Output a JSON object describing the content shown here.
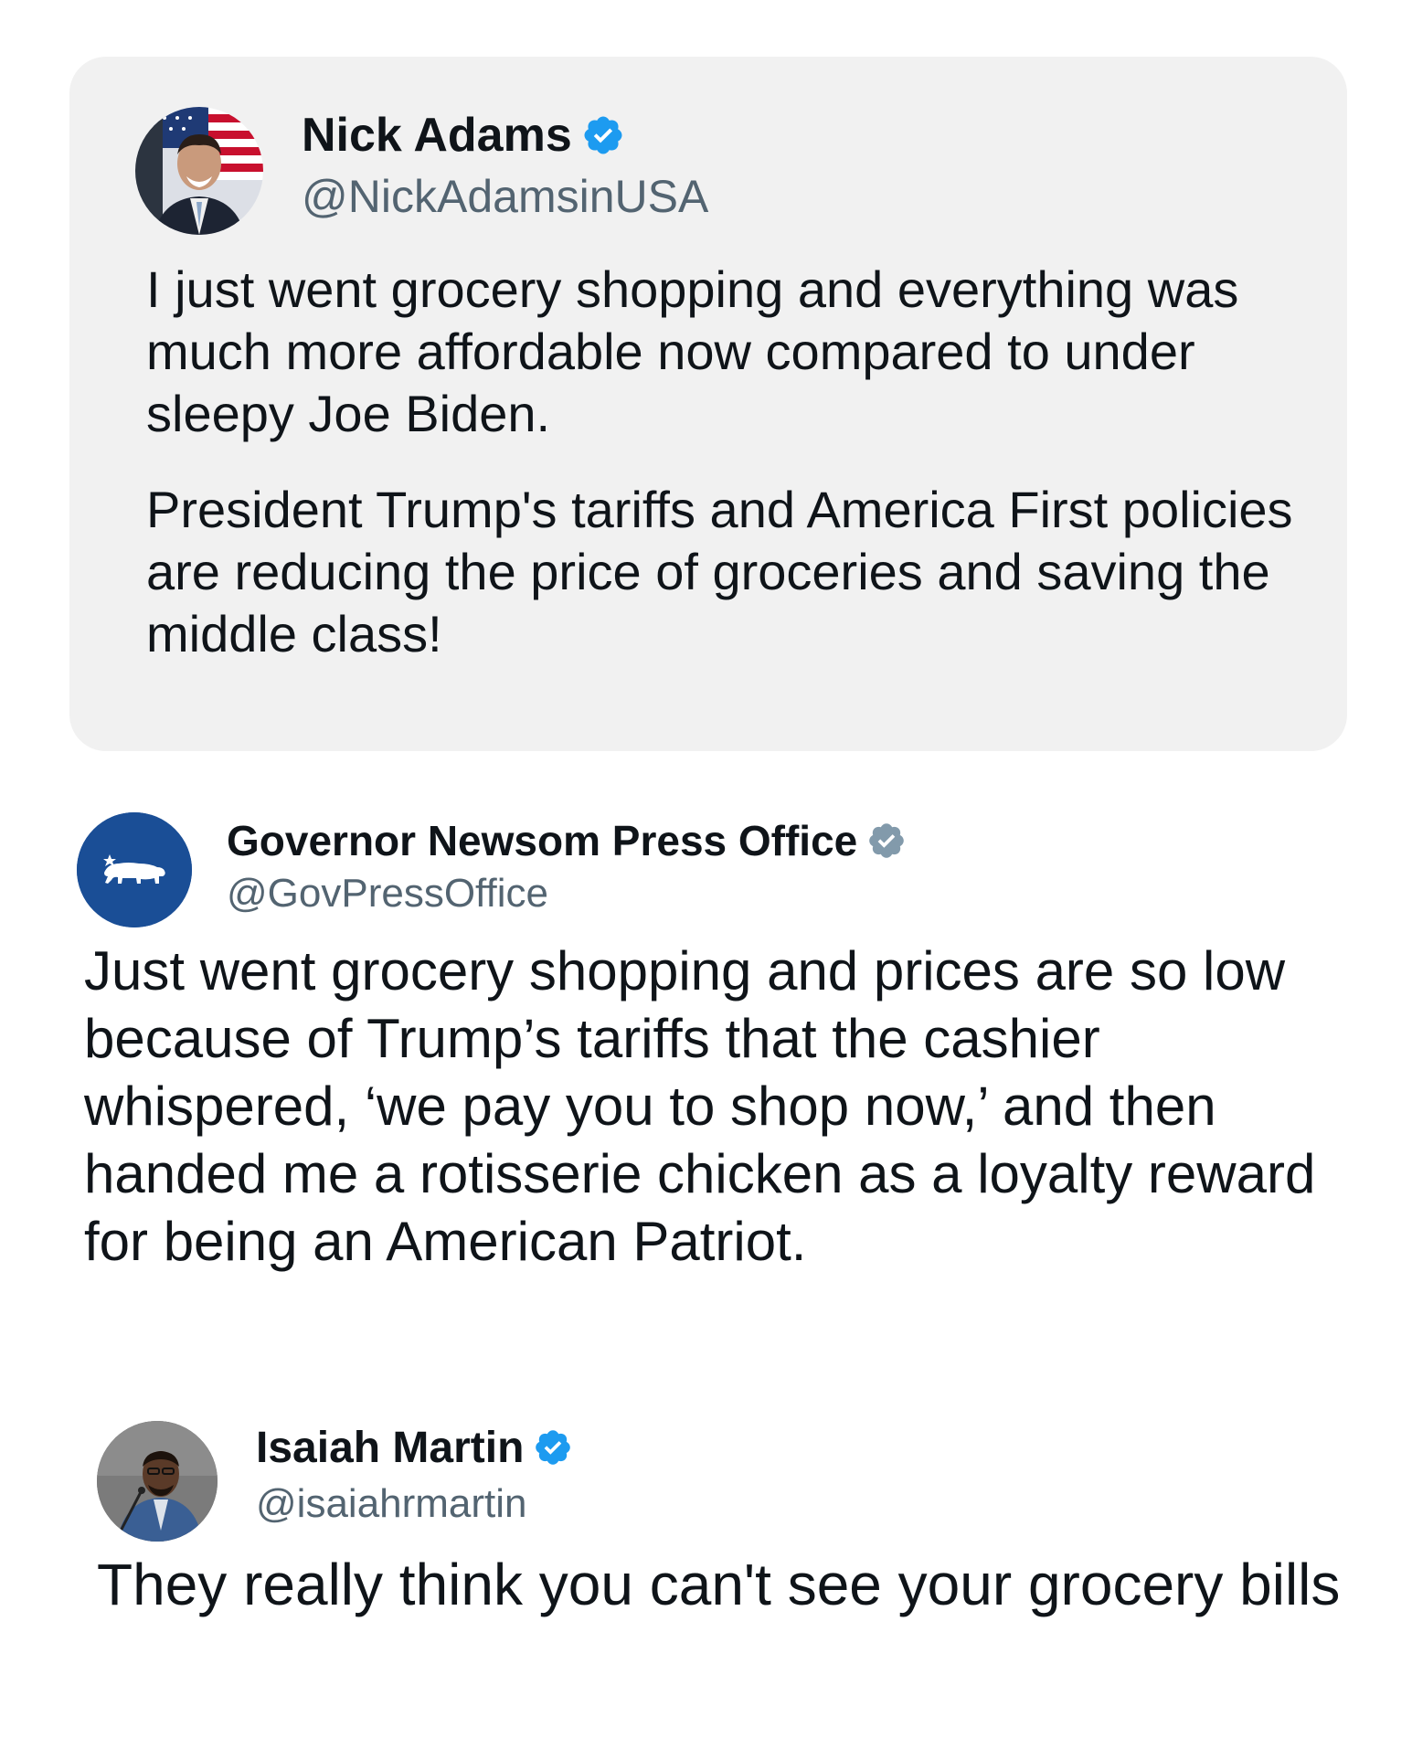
{
  "posts": [
    {
      "author_name": "Nick Adams",
      "handle": "@NickAdamsinUSA",
      "verified": true,
      "verified_color": "#1d9bf0",
      "avatar": "person-with-flag-avatar",
      "paragraphs": [
        "I just went grocery shopping and everything was much more affordable now compared to under sleepy Joe Biden.",
        "President Trump's tariffs and America First policies are reducing the price of groceries and saving the middle class!"
      ],
      "background": "#f1f1f1"
    },
    {
      "author_name": "Governor Newsom Press Office",
      "handle": "@GovPressOffice",
      "verified": true,
      "verified_color": "#829aab",
      "avatar": "california-bear-logo",
      "avatar_color": "#1a4e96",
      "body": "Just went grocery shopping and prices are so low because of Trump’s tariffs that the cashier whispered, ‘we pay you to shop now,’ and then handed me a rotisserie chicken as a loyalty reward for being an American Patriot."
    },
    {
      "author_name": "Isaiah Martin",
      "handle": "@isaiahrmartin",
      "verified": true,
      "verified_color": "#1d9bf0",
      "avatar": "person-speaking-avatar",
      "body": "They really think you can't see your grocery bills"
    }
  ]
}
